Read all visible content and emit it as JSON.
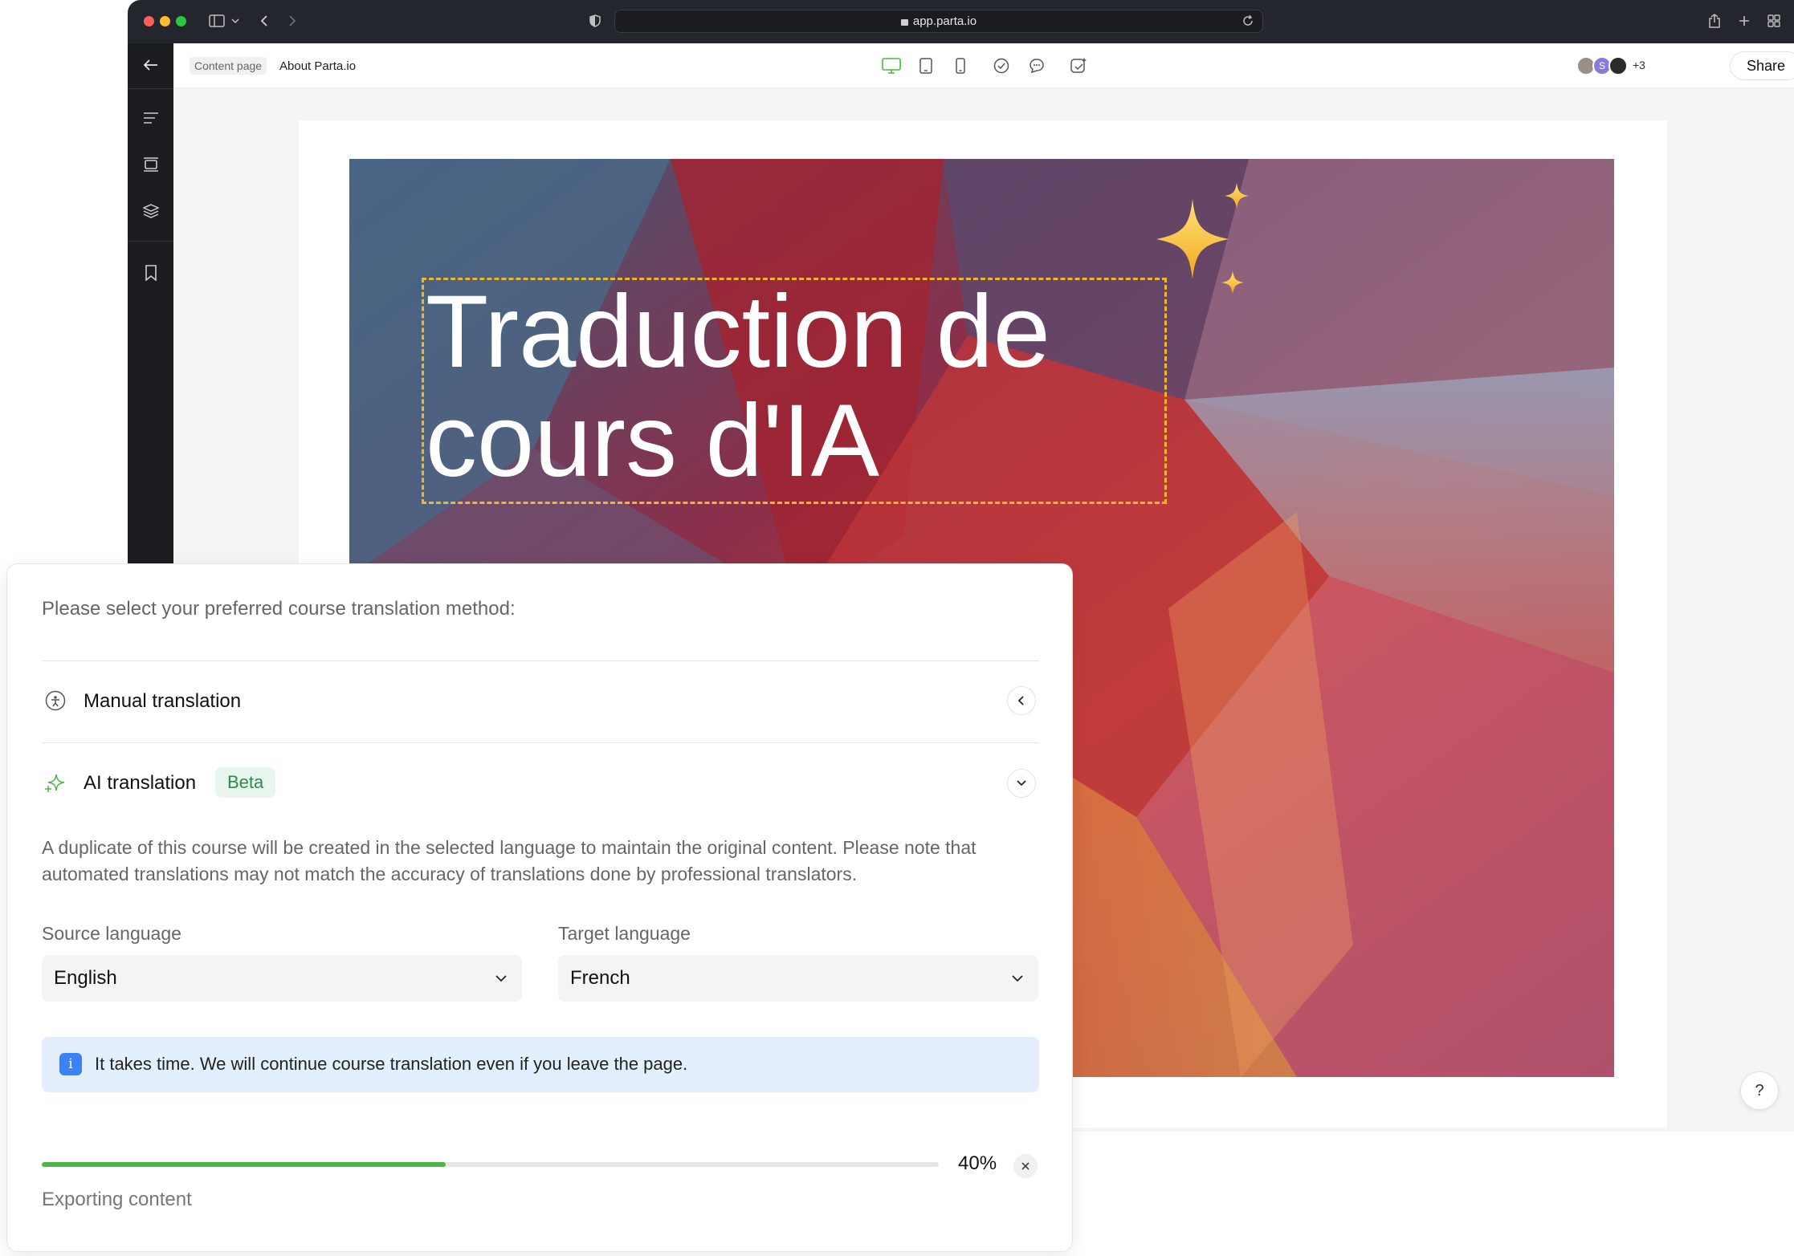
{
  "browser": {
    "url": "app.parta.io"
  },
  "toolbar": {
    "crumb_tag": "Content page",
    "page_title": "About Parta.io",
    "collaborators_more": "+3",
    "avatar_initial": "S",
    "share_label": "Share"
  },
  "hero": {
    "title": "Traduction de cours d'IA"
  },
  "help": {
    "label": "?"
  },
  "dialog": {
    "prompt": "Please select your preferred course translation method:",
    "manual": {
      "label": "Manual translation"
    },
    "ai": {
      "label": "AI translation",
      "badge": "Beta"
    },
    "description": "A duplicate of this course will be created in the selected language to maintain the original content. Please note that automated translations may not match the accuracy of translations done by professional translators.",
    "source": {
      "label": "Source language",
      "value": "English"
    },
    "target": {
      "label": "Target language",
      "value": "French"
    },
    "info": {
      "icon_label": "i",
      "text": "It takes time. We will continue course translation even if you leave the page."
    },
    "progress": {
      "value": 45,
      "label": "40%",
      "status": "Exporting content"
    }
  },
  "colors": {
    "accent_green": "#4cb648",
    "badge_green": "#2c8a4e",
    "info_blue": "#3b82f6",
    "selection_yellow": "#f2b62c"
  },
  "icons": {
    "rail": [
      "back-arrow-icon",
      "text-lines-icon",
      "layout-icon",
      "layers-icon",
      "bookmark-icon"
    ],
    "toolbar": [
      "desktop-icon",
      "tablet-icon",
      "mobile-icon",
      "check-circle-icon",
      "comment-icon",
      "ai-edit-icon",
      "play-icon"
    ]
  }
}
